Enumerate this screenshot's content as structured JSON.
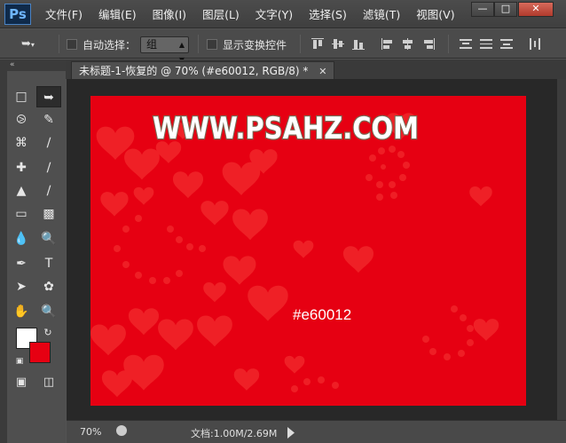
{
  "app": {
    "logo": "Ps"
  },
  "menu": [
    "文件(F)",
    "编辑(E)",
    "图像(I)",
    "图层(L)",
    "文字(Y)",
    "选择(S)",
    "滤镜(T)",
    "视图(V)"
  ],
  "window_controls": [
    "minimize",
    "maximize",
    "close"
  ],
  "options": {
    "tool_icon": "move-tool-icon",
    "auto_select_label": "自动选择：",
    "auto_select_value": "组",
    "show_transform_label": "显示变换控件"
  },
  "tools": [
    "marquee",
    "move",
    "lasso",
    "quick-select",
    "crop",
    "eyedropper",
    "healing",
    "brush",
    "stamp",
    "history-brush",
    "eraser",
    "gradient",
    "blur",
    "dodge",
    "pen",
    "type",
    "path-select",
    "shape",
    "hand",
    "zoom"
  ],
  "document": {
    "tab_title": "未标题-1-恢复的 @ 70% (#e60012, RGB/8) *",
    "canvas_color": "#e60012",
    "watermark": "WWW.PSAHZ.COM",
    "color_label": "#e60012"
  },
  "swatches": {
    "foreground": "#ffffff",
    "background": "#e60012"
  },
  "status": {
    "zoom": "70%",
    "doc": "文档:1.00M/2.69M"
  }
}
